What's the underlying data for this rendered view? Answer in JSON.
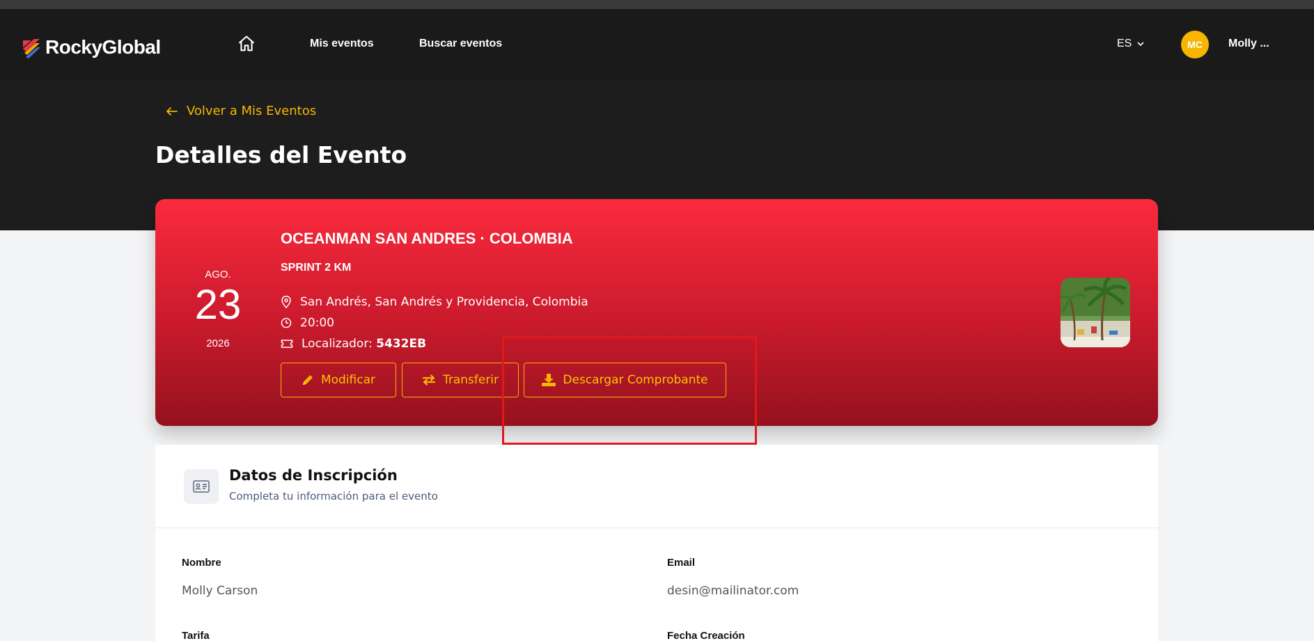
{
  "navbar": {
    "brand": "RockyGlobal",
    "links": [
      "Mis eventos",
      "Buscar eventos"
    ],
    "language": "ES",
    "avatar_initials": "MC",
    "username": "Molly ..."
  },
  "header": {
    "back_label": "Volver a Mis Eventos",
    "title": "Detalles del Evento"
  },
  "event": {
    "month": "AGO.",
    "day": "23",
    "year": "2026",
    "title": "OCEANMAN SAN ANDRES · COLOMBIA",
    "subtitle": "SPRINT 2 KM",
    "location": "San Andrés, San Andrés y Providencia, Colombia",
    "time": "20:00",
    "locator_label": "Localizador: ",
    "locator_code": "5432EB",
    "buttons": {
      "modify": "Modificar",
      "transfer": "Transferir",
      "download": "Descargar Comprobante"
    }
  },
  "registration": {
    "title": "Datos de Inscripción",
    "subtitle": "Completa tu información para el evento",
    "fields": [
      {
        "label": "Nombre",
        "value": "Molly Carson"
      },
      {
        "label": "Email",
        "value": "desin@mailinator.com"
      },
      {
        "label": "Tarifa",
        "value": ""
      },
      {
        "label": "Fecha Creación",
        "value": ""
      }
    ]
  },
  "colors": {
    "accent": "#f7b500",
    "card_top": "#fb2a3d",
    "card_bottom": "#95111e",
    "highlight": "#e01919"
  }
}
